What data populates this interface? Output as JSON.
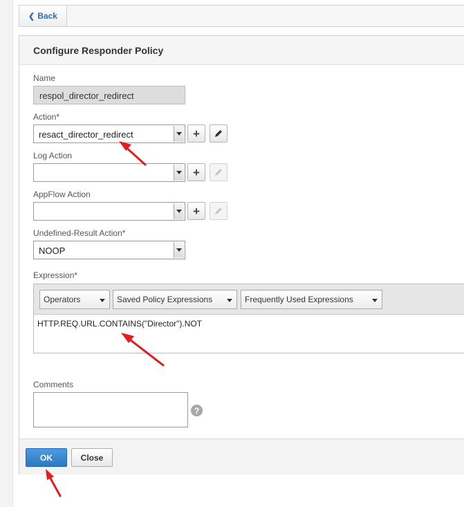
{
  "nav": {
    "back_label": "Back"
  },
  "panel": {
    "title": "Configure Responder Policy",
    "name": {
      "label": "Name",
      "value": "respol_director_redirect"
    },
    "action": {
      "label": "Action*",
      "value": "resact_director_redirect"
    },
    "log_action": {
      "label": "Log Action",
      "value": ""
    },
    "appflow_action": {
      "label": "AppFlow Action",
      "value": ""
    },
    "undefined_result_action": {
      "label": "Undefined-Result Action*",
      "value": "NOOP"
    },
    "expression": {
      "label": "Expression*",
      "toolbar": {
        "operators": "Operators",
        "saved_policy": "Saved Policy Expressions",
        "frequently_used": "Frequently Used Expressions"
      },
      "value": "HTTP.REQ.URL.CONTAINS(\"Director\").NOT"
    },
    "comments": {
      "label": "Comments",
      "value": "",
      "help_glyph": "?"
    },
    "footer": {
      "ok_label": "OK",
      "close_label": "Close"
    }
  },
  "colors": {
    "accent": "#2c77c2",
    "annotation_arrow": "#e21d1d",
    "link": "#2a6db8"
  },
  "icons": {
    "back": "arrow-left-icon",
    "add": "plus-icon",
    "edit": "pencil-icon",
    "help": "question-icon"
  }
}
